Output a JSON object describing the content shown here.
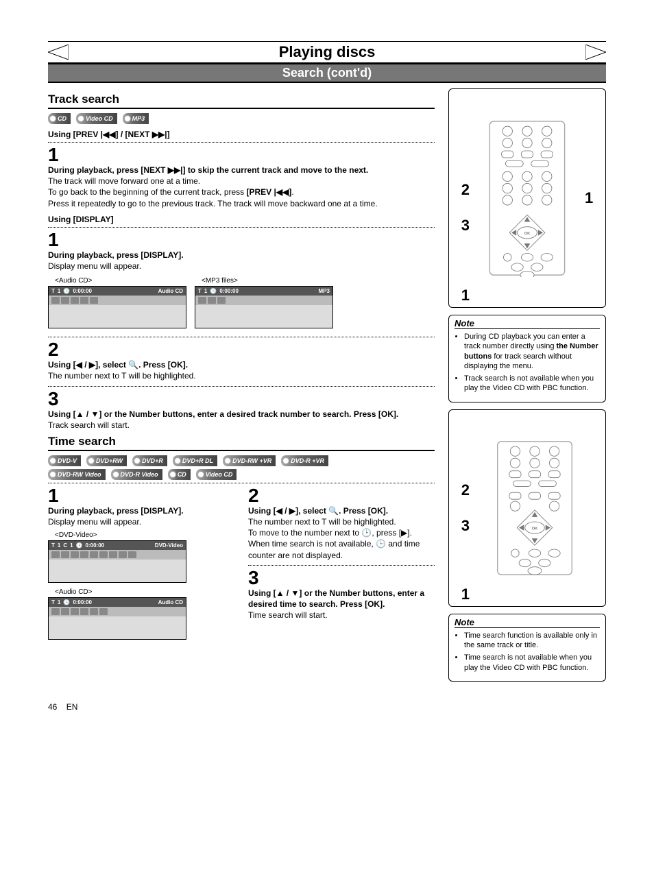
{
  "page": {
    "title": "Playing discs",
    "subtitle": "Search (cont'd)",
    "page_number": "46",
    "lang": "EN"
  },
  "track_search": {
    "heading": "Track search",
    "badges": [
      "CD",
      "Video CD",
      "MP3"
    ],
    "using_prev_next": "Using [PREV |◀◀] / [NEXT ▶▶|]",
    "step1_num": "1",
    "step1_bold": "During playback, press [NEXT ▶▶|] to skip the current track and move to the next.",
    "step1_p1": "The track will move forward one at a time.",
    "step1_p2a": "To go back to the beginning of the current track, press ",
    "step1_p2_bold": "[PREV |◀◀]",
    "step1_p2b": ".",
    "step1_p3": "Press it repeatedly to go to the previous track. The track will move backward one at a time.",
    "using_display": "Using [DISPLAY]",
    "d_step1_num": "1",
    "d_step1_bold": "During playback, press [DISPLAY].",
    "d_step1_p": "Display menu will appear.",
    "osd_audio_label": "<Audio CD>",
    "osd_mp3_label": "<MP3 files>",
    "osd_audio_top_track": "1",
    "osd_audio_top_time": "0:00:00",
    "osd_audio_top_type": "Audio CD",
    "osd_mp3_top_track": "1",
    "osd_mp3_top_time": "0:00:00",
    "osd_mp3_top_type": "MP3",
    "d_step2_num": "2",
    "d_step2_bold": "Using [◀ / ▶], select 🔍. Press [OK].",
    "d_step2_p": "The number next to T will be highlighted.",
    "d_step3_num": "3",
    "d_step3_bold": "Using [▲ / ▼] or the Number buttons, enter a desired track number to search. Press [OK].",
    "d_step3_p": "Track search will start."
  },
  "time_search": {
    "heading": "Time search",
    "badges_row1": [
      "DVD-V",
      "DVD+RW",
      "DVD+R",
      "DVD+R DL",
      "DVD-RW +VR",
      "DVD-R +VR"
    ],
    "badges_row2": [
      "DVD-RW Video",
      "DVD-R Video",
      "CD",
      "Video CD"
    ],
    "col1_step1_num": "1",
    "col1_step1_bold": "During playback, press [DISPLAY].",
    "col1_step1_p": "Display menu will appear.",
    "osd_dvd_label": "<DVD-Video>",
    "osd_dvd_top_t": "1",
    "osd_dvd_top_c": "1",
    "osd_dvd_top_time": "0:00:00",
    "osd_dvd_top_type": "DVD-Video",
    "osd_cd_label": "<Audio CD>",
    "osd_cd_top_track": "1",
    "osd_cd_top_time": "0:00:00",
    "osd_cd_top_type": "Audio CD",
    "col2_step2_num": "2",
    "col2_step2_bold": "Using [◀ / ▶], select 🔍. Press [OK].",
    "col2_step2_p1": "The number next to T will be highlighted.",
    "col2_step2_p2": "To move to the number next to 🕒, press [▶].",
    "col2_step2_p3": "When time search is not available, 🕒 and time counter are not displayed.",
    "col2_step3_num": "3",
    "col2_step3_bold": "Using [▲ / ▼] or the Number buttons, enter a desired time to search. Press [OK].",
    "col2_step3_p": "Time search will start."
  },
  "notes": {
    "note1_hd": "Note",
    "note1_items_a": "During CD playback you can enter a track number directly using ",
    "note1_items_a_bold": "the Number buttons",
    "note1_items_a2": " for track search without displaying the menu.",
    "note1_items_b": "Track search is not available when you play the Video CD with PBC function.",
    "note2_hd": "Note",
    "note2_items_a": "Time search function is available only in the same track or title.",
    "note2_items_b": "Time search is not available when you play the Video CD with PBC function."
  },
  "remote": {
    "callout_1": "1",
    "callout_2": "2",
    "callout_3": "3",
    "callout_bottom_1": "1"
  }
}
